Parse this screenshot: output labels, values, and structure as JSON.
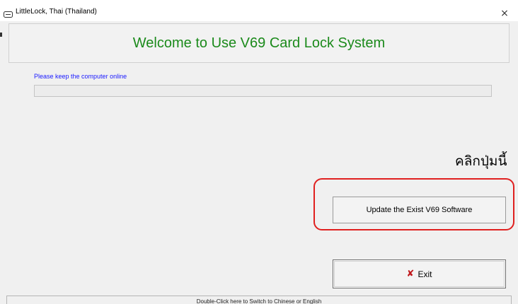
{
  "window": {
    "title": "LittleLock, Thai (Thailand)",
    "close_glyph": "×"
  },
  "header": {
    "title": "Welcome to Use V69 Card Lock System"
  },
  "main": {
    "online_note": "Please keep the computer online",
    "progress": 0,
    "annotation_thai": "คลิกปุ่มนี้",
    "update_button_label": "Update the Exist V69 Software",
    "exit_button_label": "Exit",
    "exit_icon": "x-icon"
  },
  "status_bar": {
    "text": "Double-Click here to Switch to Chinese or English"
  },
  "colors": {
    "title_green": "#1b8a1b",
    "note_blue": "#1a1aff",
    "highlight_red": "#e0201f",
    "exit_icon_red": "#c0181c"
  }
}
